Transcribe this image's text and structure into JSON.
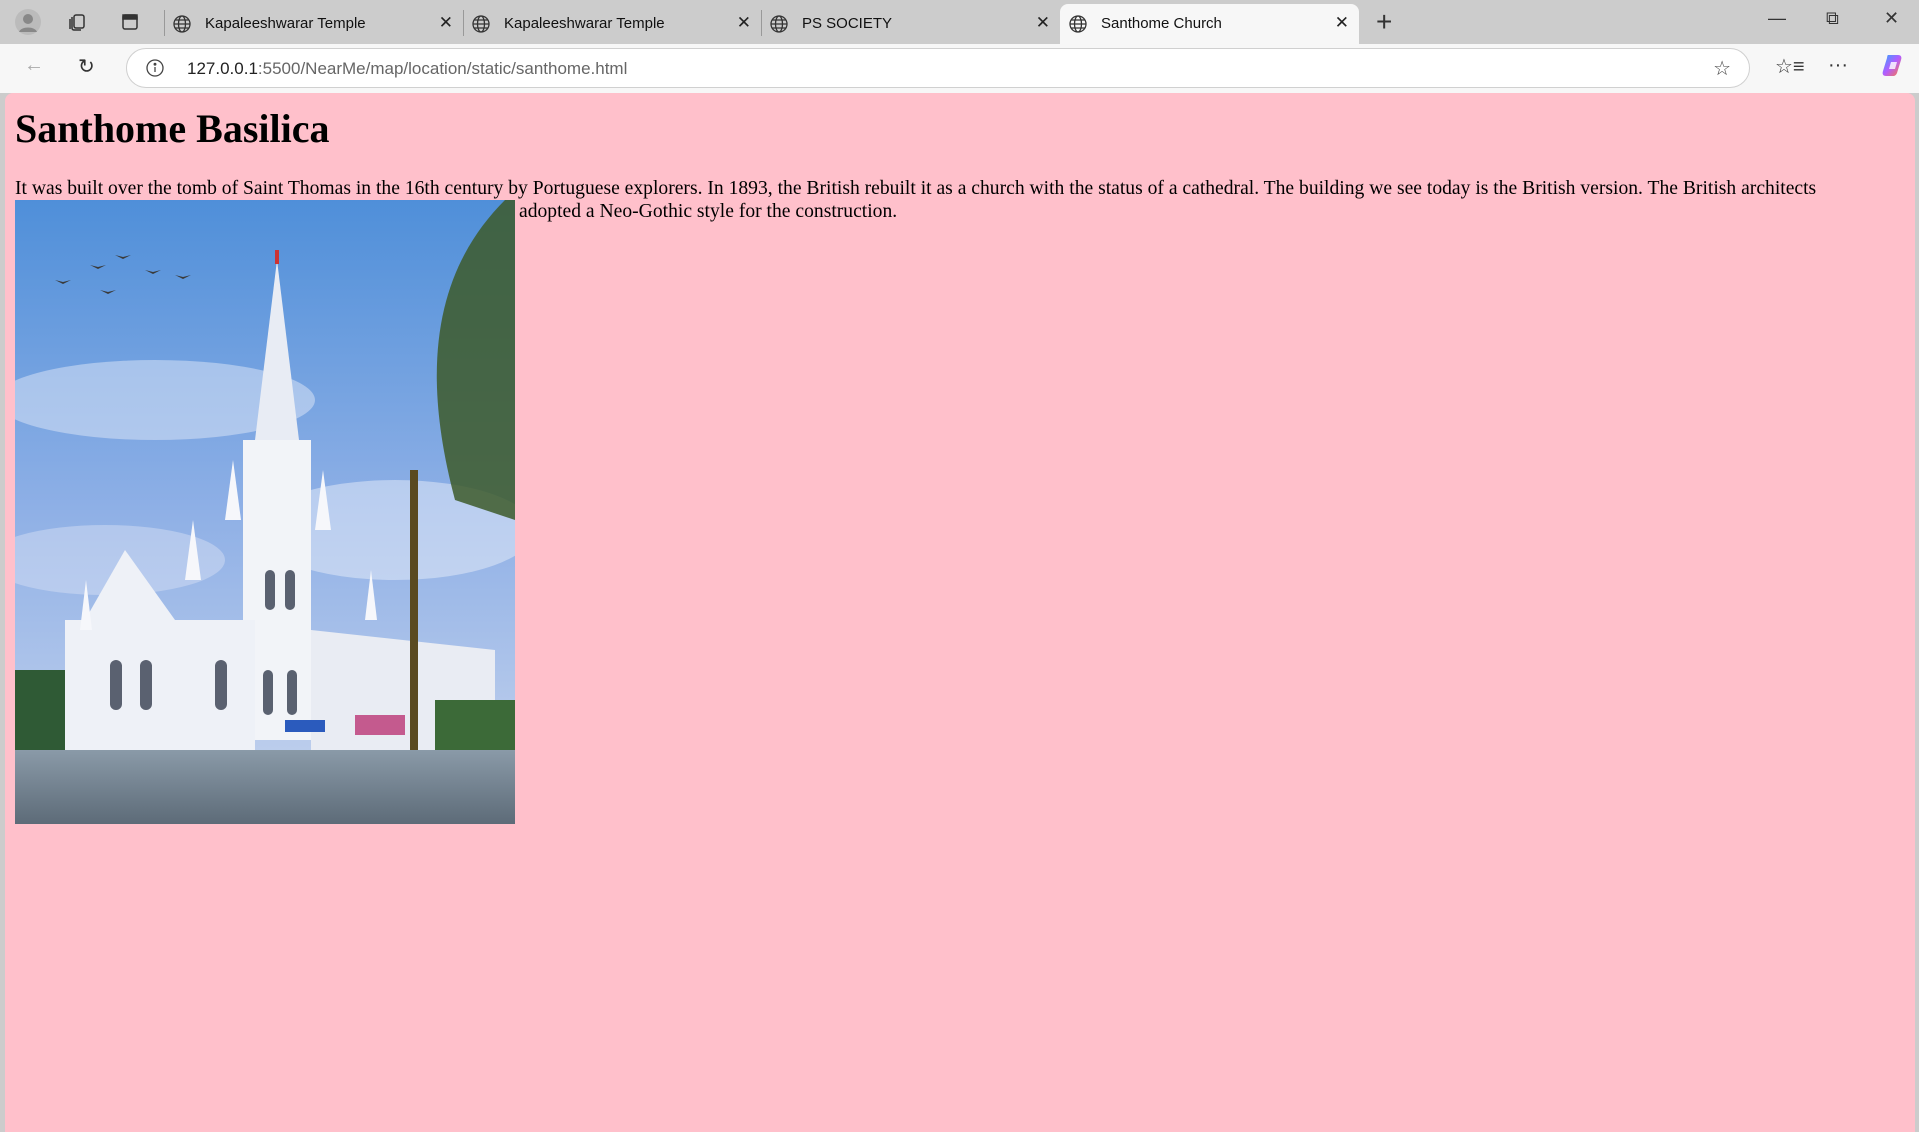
{
  "browser": {
    "tabs": [
      {
        "title": "Kapaleeshwarar Temple",
        "active": false
      },
      {
        "title": "Kapaleeshwarar Temple",
        "active": false
      },
      {
        "title": "PS SOCIETY",
        "active": false
      },
      {
        "title": "Santhome Church",
        "active": true
      }
    ],
    "new_tab_label": "+",
    "close_label": "✕",
    "url_host": "127.0.0.1",
    "url_rest": ":5500/NearMe/map/location/static/santhome.html"
  },
  "page": {
    "heading": "Santhome Basilica",
    "paragraph": "It was built over the tomb of Saint Thomas in the 16th century by Portuguese explorers. In 1893, the British rebuilt it as a church with the status of a cathedral. The building we see today is the British version. The British architects adopted a Neo-Gothic style for the construction.",
    "image_subject": "Santhome Basilica church photo"
  },
  "colors": {
    "page_bg": "#ffc0cb",
    "tabbar_bg": "#cccccc"
  }
}
